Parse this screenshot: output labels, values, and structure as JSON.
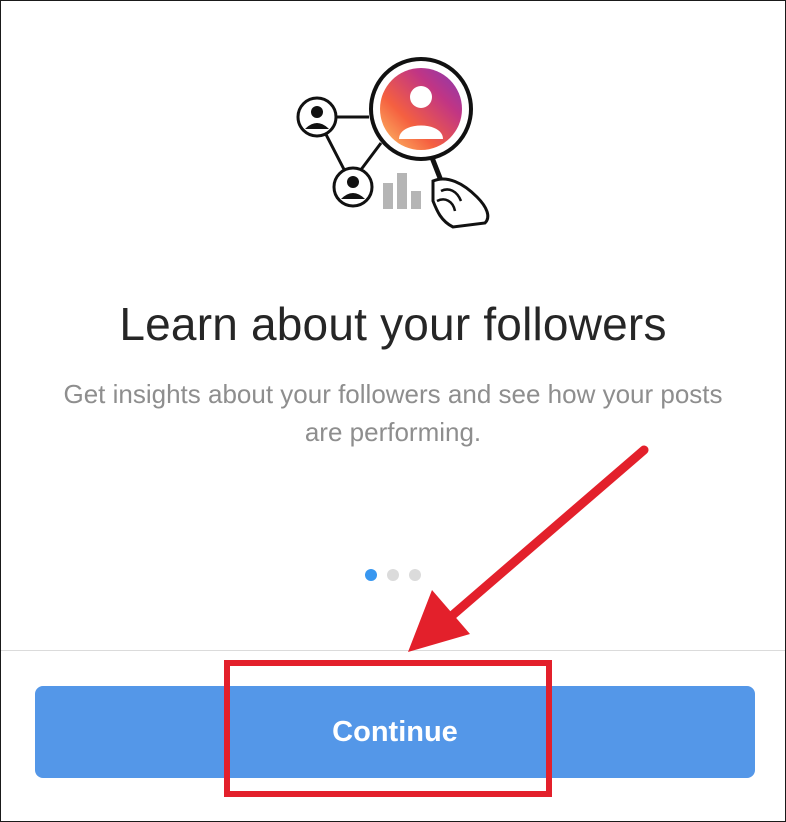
{
  "onboarding": {
    "title": "Learn about your followers",
    "subtitle": "Get insights about your followers and see how your posts are performing.",
    "pager": {
      "total": 3,
      "active_index": 0
    },
    "continue_label": "Continue"
  },
  "colors": {
    "accent_blue": "#5497e8",
    "active_dot": "#3897f0",
    "annotation_red": "#e3202b"
  }
}
